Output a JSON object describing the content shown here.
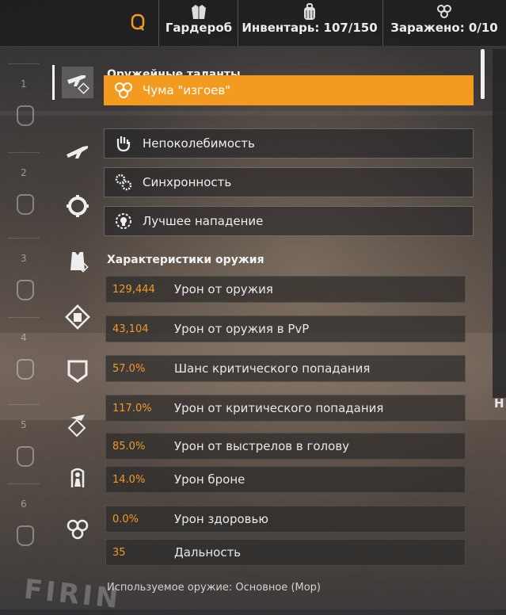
{
  "topbar": {
    "wardrobe_label": "Гардероб",
    "inventory_label": "Инвентарь: 107/150",
    "infected_label": "Заражено: 0/10"
  },
  "left_slots": [
    "1",
    "2",
    "3",
    "4",
    "5",
    "6"
  ],
  "talents": {
    "section_title": "Оружейные таланты",
    "items": [
      {
        "name": "Чума \"изгоев\"",
        "icon": "biohazard-swarm-icon",
        "selected": true
      },
      {
        "name": "Непоколебимость",
        "icon": "hand-icon",
        "selected": false
      },
      {
        "name": "Синхронность",
        "icon": "gears-icon",
        "selected": false
      },
      {
        "name": "Лучшее нападение",
        "icon": "skull-badge-icon",
        "selected": false
      }
    ]
  },
  "stats": {
    "section_title": "Характеристики оружия",
    "items": [
      {
        "value": "129,444",
        "name": "Урон от оружия"
      },
      {
        "value": "43,104",
        "name": "Урон от оружия в PvP"
      },
      {
        "value": "57.0%",
        "name": "Шанс критического попадания"
      },
      {
        "value": "117.0%",
        "name": "Урон от критического попадания"
      },
      {
        "value": "85.0%",
        "name": "Урон от выстрелов в голову"
      },
      {
        "value": "14.0%",
        "name": "Урон броне"
      },
      {
        "value": "0.0%",
        "name": "Урон здоровью"
      },
      {
        "value": "35",
        "name": "Дальность"
      }
    ]
  },
  "footer_text": "Используемое оружие: Основное (Мор)",
  "peek_letter": "Н",
  "floor_text": "FIRIN",
  "colors": {
    "accent": "#f39a20",
    "value": "#f29a2a"
  }
}
